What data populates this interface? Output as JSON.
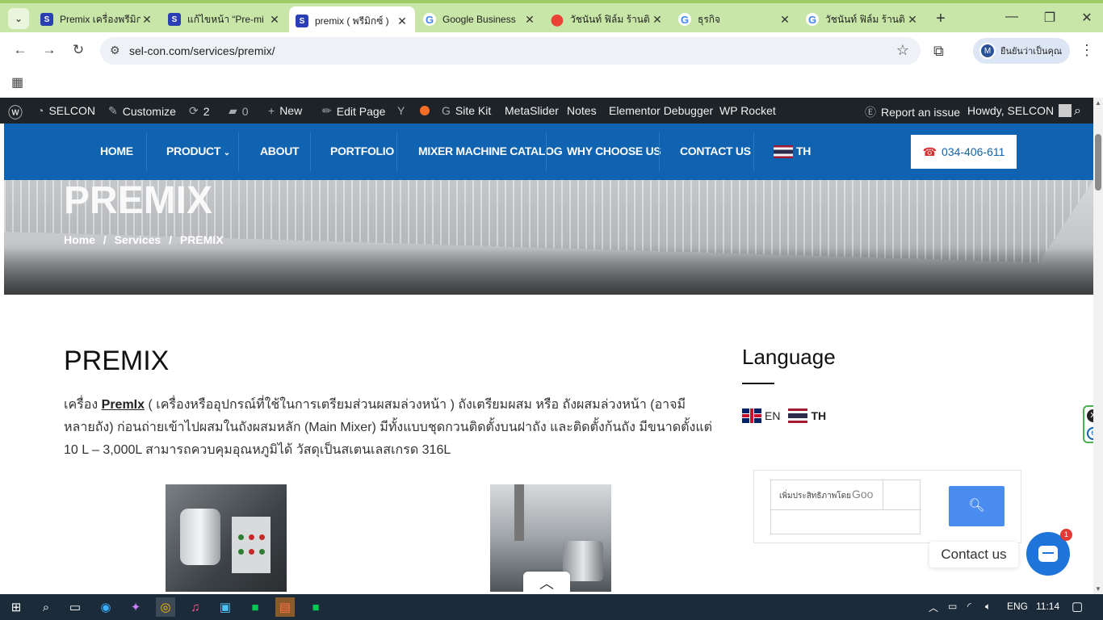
{
  "browser": {
    "tabs": [
      {
        "title": "Premix เครื่องพรีมิก",
        "favicon": "selcon",
        "active": false
      },
      {
        "title": "แก้ไขหน้า “Pre-mi",
        "favicon": "selcon",
        "active": false
      },
      {
        "title": "premix ( พรีมิกซ์ )",
        "favicon": "selcon",
        "active": true
      },
      {
        "title": "Google Business",
        "favicon": "google",
        "active": false
      },
      {
        "title": "วัชนันท์ ฟิล์ม ร้านติ",
        "favicon": "maps",
        "active": false
      },
      {
        "title": "ธุรกิจ",
        "favicon": "google",
        "active": false
      },
      {
        "title": "วัชนันท์ ฟิล์ม ร้านติ",
        "favicon": "google",
        "active": false
      }
    ],
    "url": "sel-con.com/services/premix/",
    "profile_label": "ยืนยันว่าเป็นคุณ",
    "profile_initial": "M"
  },
  "wp_admin_bar": {
    "site": "SELCON",
    "customize": "Customize",
    "updates": "2",
    "comments": "0",
    "new": "New",
    "edit_page": "Edit Page",
    "site_kit": "Site Kit",
    "metaslider": "MetaSlider",
    "notes": "Notes",
    "elementor_debugger": "Elementor Debugger",
    "wp_rocket": "WP Rocket",
    "report_issue": "Report an issue",
    "howdy": "Howdy, SELCON"
  },
  "site_nav": {
    "items": [
      "HOME",
      "PRODUCT",
      "ABOUT",
      "PORTFOLIO",
      "MIXER MACHINE CATALOG",
      "WHY CHOOSE US",
      "CONTACT US"
    ],
    "language": "TH",
    "phone": "034-406-611"
  },
  "hero": {
    "title": "PREMIX",
    "breadcrumb": [
      "Home",
      "/",
      "Services",
      "/",
      "PREMIX"
    ]
  },
  "content": {
    "title": "PREMIX",
    "body_prefix": "เครื่อง ",
    "body_bold": "PremIx",
    "body_rest": " ( เครื่องหรืออุปกรณ์ที่ใช้ในการเตรียมส่วนผสมล่วงหน้า )  ถังเตรียมผสม หรือ ถังผสมล่วงหน้า (อาจมีหลายถัง) ก่อนถ่ายเข้าไปผสมในถังผสมหลัก (Main Mixer) มีทั้งแบบชุดกวนติดตั้งบนฝาถัง และติดตั้งก้นถัง มีขนาดตั้งแต่ 10 L – 3,000L สามารถควบคุมอุณหภูมิได้ วัสดุเป็นสเตนเลสเกรด 316L"
  },
  "sidebar": {
    "language_title": "Language",
    "lang_en": "EN",
    "lang_th": "TH",
    "search_placeholder": "เพิ่มประสิทธิภาพโดย",
    "search_brand": "Goo"
  },
  "chat": {
    "label": "Contact us",
    "badge": "1"
  },
  "taskbar": {
    "lang": "ENG",
    "time": "11:14"
  },
  "colors": {
    "nav_blue": "#0f63b0",
    "wp_bar": "#1d2327",
    "tab_strip": "#c8e6a8",
    "search_button": "#4a8cf0",
    "chat_button": "#1e74d8"
  }
}
